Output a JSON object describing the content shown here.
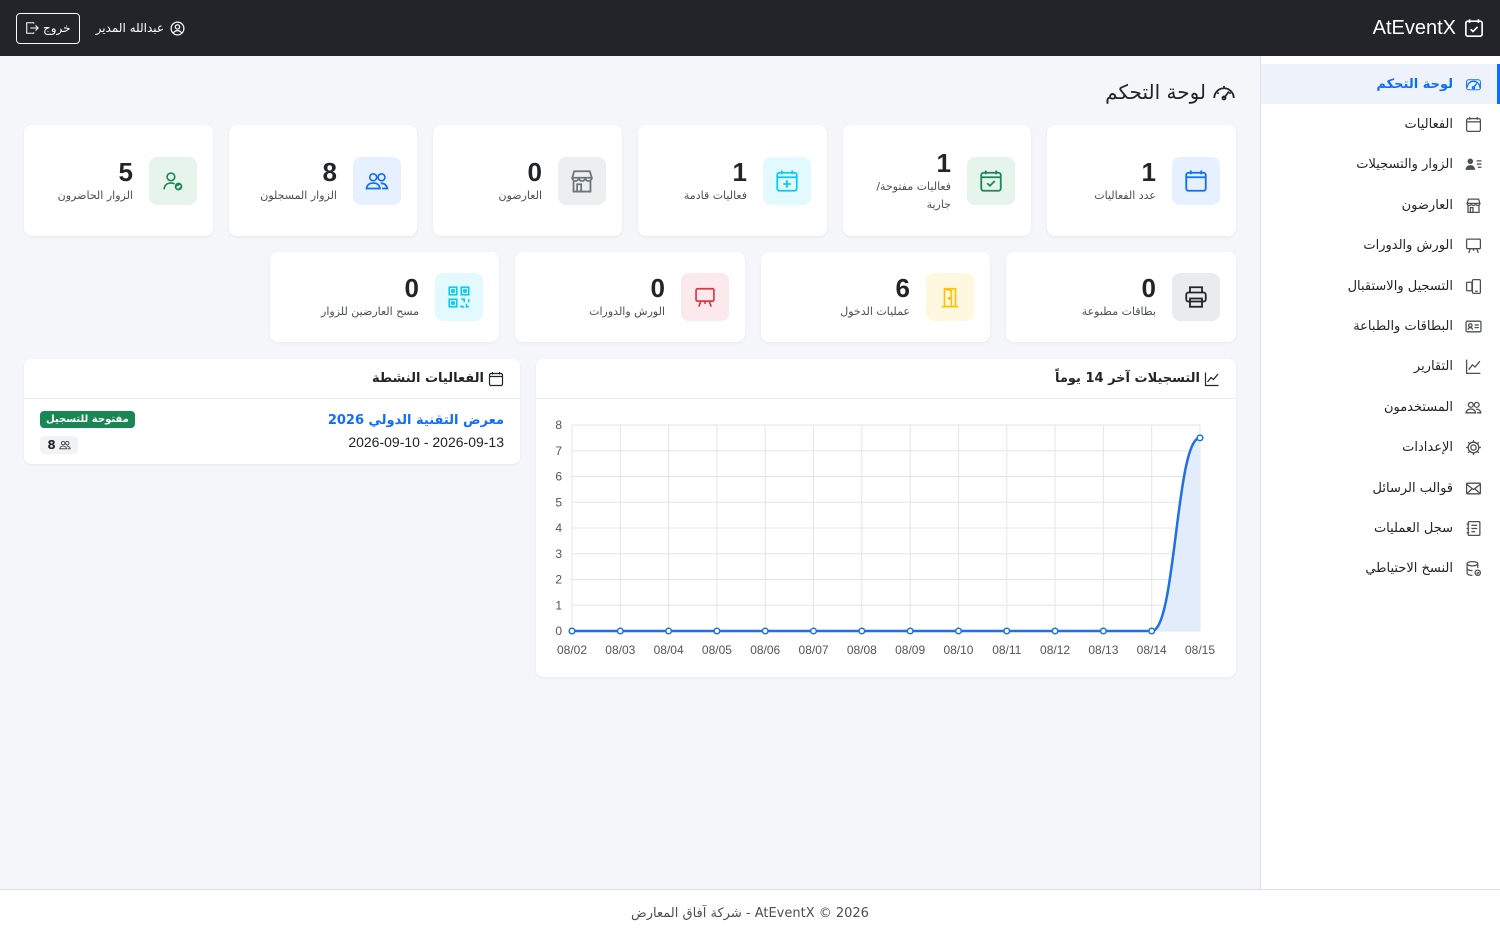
{
  "app": {
    "name": "AtEventX"
  },
  "navbar": {
    "user_name": "عبدالله المدير",
    "logout_label": "خروج"
  },
  "sidebar": {
    "items": [
      {
        "label": "لوحة التحكم",
        "icon": "speedometer-icon",
        "active": true
      },
      {
        "label": "الفعاليات",
        "icon": "calendar-icon"
      },
      {
        "label": "الزوار والتسجيلات",
        "icon": "person-lines-icon"
      },
      {
        "label": "العارضون",
        "icon": "shop-icon"
      },
      {
        "label": "الورش والدورات",
        "icon": "easel-icon"
      },
      {
        "label": "التسجيل والاستقبال",
        "icon": "phone-icon"
      },
      {
        "label": "البطاقات والطباعة",
        "icon": "badge-card-icon"
      },
      {
        "label": "التقارير",
        "icon": "graph-icon"
      },
      {
        "label": "المستخدمون",
        "icon": "people-icon"
      },
      {
        "label": "الإعدادات",
        "icon": "gear-icon"
      },
      {
        "label": "قوالب الرسائل",
        "icon": "envelope-icon"
      },
      {
        "label": "سجل العمليات",
        "icon": "journal-icon"
      },
      {
        "label": "النسخ الاحتياطي",
        "icon": "database-icon"
      }
    ]
  },
  "page": {
    "title": "لوحة التحكم"
  },
  "stats": [
    {
      "value": "1",
      "label": "عدد الفعاليات",
      "icon": "calendar-icon",
      "color": "#0d6efd",
      "bg": "#e7f0ff"
    },
    {
      "value": "1",
      "label": "فعاليات مفتوحة/ جارية",
      "icon": "calendar-check-icon",
      "color": "#198754",
      "bg": "#e6f4ec"
    },
    {
      "value": "1",
      "label": "فعاليات قادمة",
      "icon": "calendar-plus-icon",
      "color": "#0dcaf0",
      "bg": "#e2f9fd"
    },
    {
      "value": "0",
      "label": "العارضون",
      "icon": "shop-icon",
      "color": "#6c757d",
      "bg": "#eceef0"
    },
    {
      "value": "8",
      "label": "الزوار المسجلون",
      "icon": "people-icon",
      "color": "#0d6efd",
      "bg": "#e7f0ff"
    },
    {
      "value": "5",
      "label": "الزوار الحاضرون",
      "icon": "person-check-icon",
      "color": "#198754",
      "bg": "#e6f4ec"
    },
    {
      "value": "0",
      "label": "بطاقات مطبوعة",
      "icon": "printer-icon",
      "color": "#212529",
      "bg": "#e9ecef"
    },
    {
      "value": "6",
      "label": "عمليات الدخول",
      "icon": "door-open-icon",
      "color": "#ffc107",
      "bg": "#fff8e1"
    },
    {
      "value": "0",
      "label": "الورش والدورات",
      "icon": "easel-icon",
      "color": "#dc3545",
      "bg": "#fbe9eb"
    },
    {
      "value": "0",
      "label": "مسح العارضين للزوار",
      "icon": "qr-code-icon",
      "color": "#0dcaf0",
      "bg": "#e2f9fd"
    }
  ],
  "active_events": {
    "title": "الفعاليات النشطة",
    "items": [
      {
        "name": "معرض التقنية الدولي 2026",
        "dates": "2026-09-10 - 2026-09-13",
        "status": "مفتوحة للتسجيل",
        "visitors": "8"
      }
    ]
  },
  "registrations_chart": {
    "title": "التسجيلات آخر 14 يوماً"
  },
  "chart_data": {
    "type": "area",
    "categories": [
      "08/02",
      "08/03",
      "08/04",
      "08/05",
      "08/06",
      "08/07",
      "08/08",
      "08/09",
      "08/10",
      "08/11",
      "08/12",
      "08/13",
      "08/14",
      "08/15"
    ],
    "series": [
      {
        "values": [
          0,
          0,
          0,
          0,
          0,
          0,
          0,
          0,
          0,
          0,
          0,
          0,
          0,
          7.5
        ]
      }
    ],
    "ylim": [
      0,
      8
    ],
    "yticks": [
      "0",
      "1",
      "2",
      "3",
      "4",
      "5",
      "6",
      "7",
      "8"
    ],
    "grid": true,
    "line_color": "#1f6fe5",
    "fill_color": "#e3ecfb"
  },
  "footer": {
    "text": "AtEventX © 2026 - شركة آفاق المعارض"
  }
}
